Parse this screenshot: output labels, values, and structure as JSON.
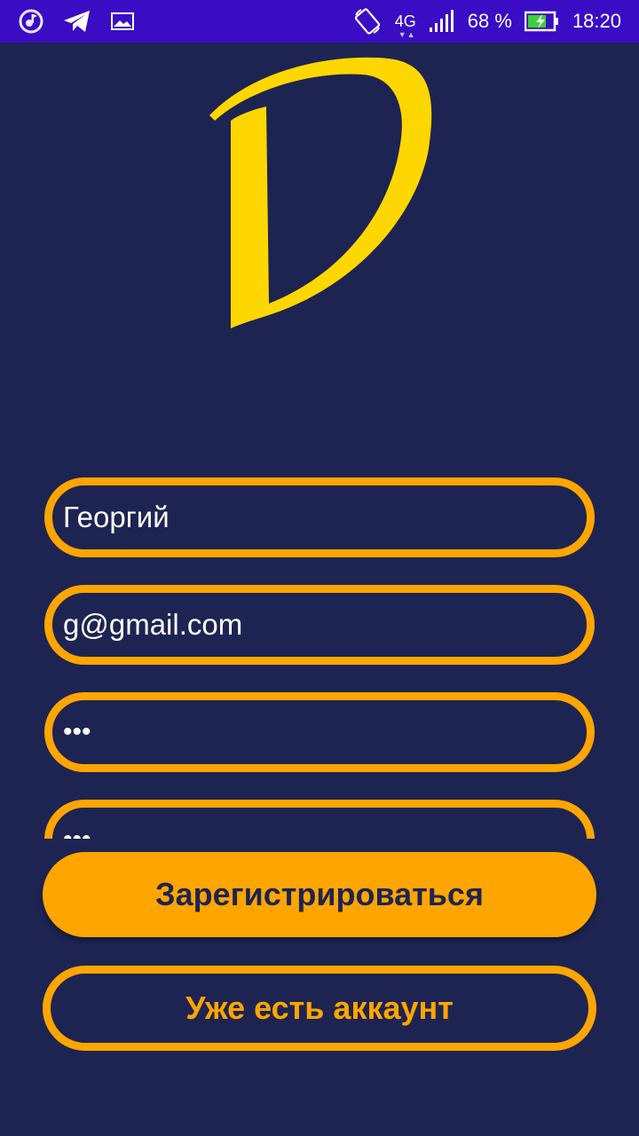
{
  "status_bar": {
    "network": "4G",
    "battery": "68 %",
    "time": "18:20",
    "icons": [
      "music-app-icon",
      "telegram-icon",
      "gallery-icon",
      "rotate-icon",
      "signal-icon",
      "battery-charging-icon"
    ]
  },
  "colors": {
    "background": "#1e2452",
    "status_bar": "#3a0cc4",
    "accent": "#ffa500",
    "logo": "#ffd700",
    "text": "#ffffff"
  },
  "form": {
    "name_value": "Георгий",
    "email_value": "g@gmail.com",
    "password_value": "•••",
    "confirm_password_value": "•••"
  },
  "buttons": {
    "register_label": "Зарегистрироваться",
    "login_label": "Уже есть аккаунт"
  }
}
